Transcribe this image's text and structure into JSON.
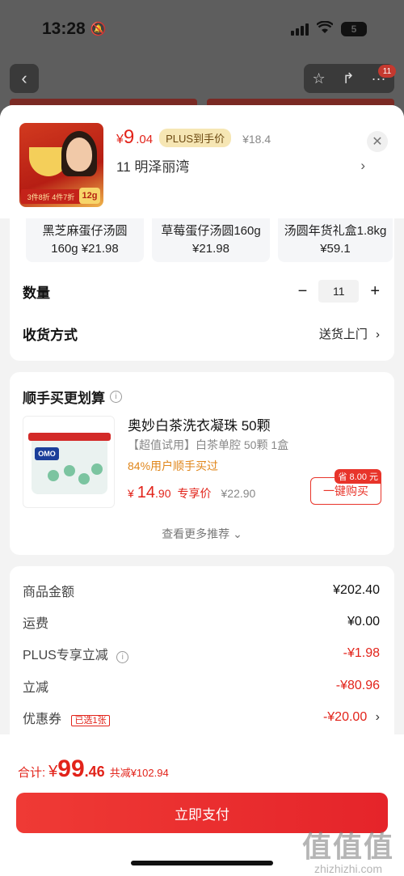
{
  "status_bar": {
    "time": "13:28",
    "battery": "5"
  },
  "nav": {
    "badge": "11"
  },
  "product": {
    "thumb_promo": "3件8折 4件7折",
    "thumb_gram": "12g",
    "price_currency": "¥",
    "price_int": "9",
    "price_dec": ".04",
    "plus_tag": "PLUS到手价",
    "orig_price": "¥18.4",
    "address": "11  明泽丽湾"
  },
  "variants": [
    {
      "name": "黑芝麻蛋仔汤圆",
      "price": "160g ¥21.98"
    },
    {
      "name": "草莓蛋仔汤圆160g",
      "price": "¥21.98"
    },
    {
      "name": "汤圆年货礼盒1.8kg",
      "price": "¥59.1"
    }
  ],
  "quantity": {
    "label": "数量",
    "value": "11"
  },
  "shipping": {
    "label": "收货方式",
    "value": "送货上门"
  },
  "recommend": {
    "title": "顺手买更划算",
    "img_logo": "OMO",
    "name": "奥妙白茶洗衣凝珠 50颗",
    "spec": "【超值试用】白茶单腔  50颗 1盒",
    "social": "84%用户顺手买过",
    "price_currency": "¥",
    "price_int": "14",
    "price_dec": ".90",
    "price_label": "专享价",
    "orig_price": "¥22.90",
    "save_tag": "省 8.00 元",
    "buy_label": "一键购买",
    "more": "查看更多推荐"
  },
  "summary": [
    {
      "label": "商品金额",
      "value": "¥202.40"
    },
    {
      "label": "运费",
      "value": "¥0.00"
    },
    {
      "label": "PLUS专享立减",
      "value": "-¥1.98"
    },
    {
      "label": "立减",
      "value": "-¥80.96"
    },
    {
      "label": "优惠券",
      "tag": "已选1张",
      "value": "-¥20.00"
    }
  ],
  "footer": {
    "total_label": "合计:",
    "total_currency": "¥",
    "total_int": "99",
    "total_dec": ".46",
    "total_save": "共减¥102.94",
    "pay_label": "立即支付"
  },
  "watermark": {
    "big": "值值值",
    "small": "zhizhizhi.com"
  },
  "colors": {
    "accent": "#e2231a",
    "plus_tag_bg": "#f6e6b4",
    "orange": "#e0861b"
  }
}
